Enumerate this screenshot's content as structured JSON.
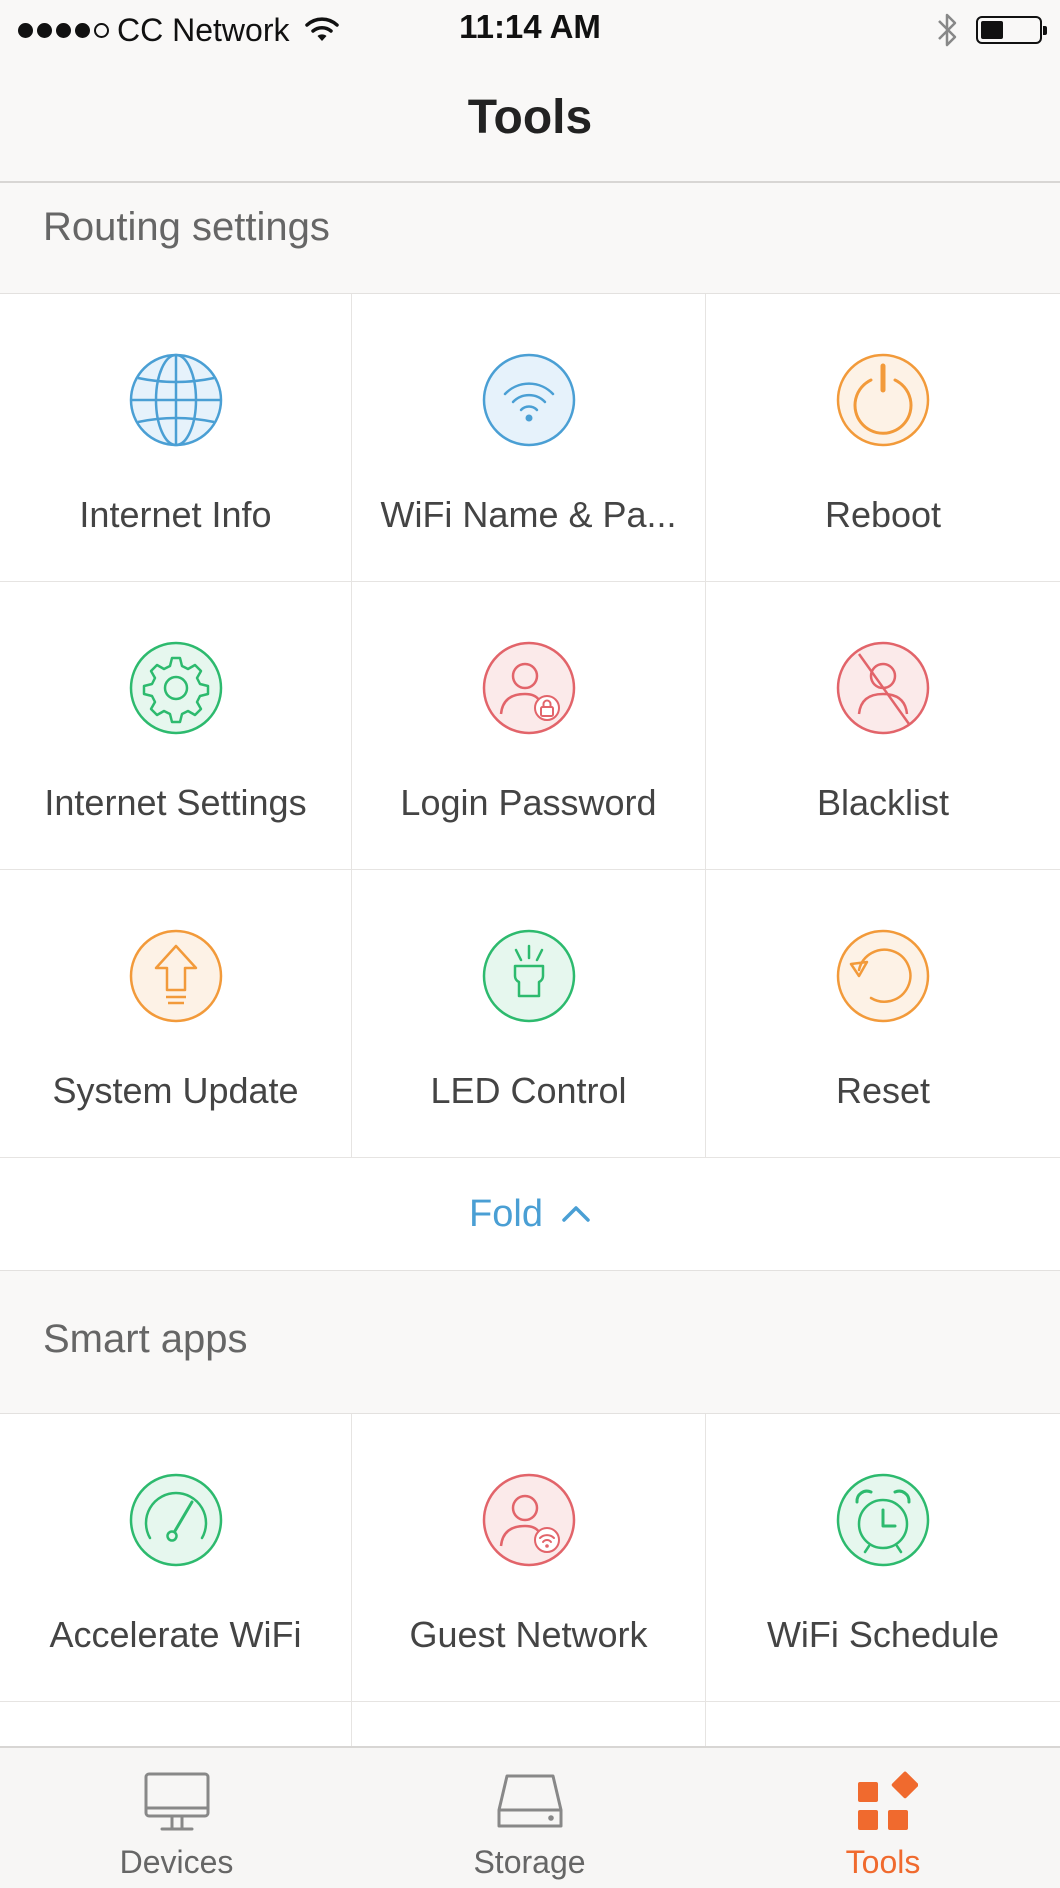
{
  "status_bar": {
    "carrier": "CC Network",
    "time": "11:14 AM",
    "battery_level": 0.4,
    "signal_bars": 4
  },
  "nav": {
    "title": "Tools"
  },
  "routing": {
    "header": "Routing settings",
    "items": [
      {
        "label": "Internet Info",
        "icon": "globe-icon",
        "color": "#4a9fd4"
      },
      {
        "label": "WiFi Name & Pa...",
        "icon": "wifi-icon",
        "color": "#4a9fd4"
      },
      {
        "label": "Reboot",
        "icon": "power-icon",
        "color": "#f29a3a"
      },
      {
        "label": "Internet Settings",
        "icon": "gear-icon",
        "color": "#2dba6e"
      },
      {
        "label": "Login Password",
        "icon": "user-lock-icon",
        "color": "#e2646a"
      },
      {
        "label": "Blacklist",
        "icon": "user-blocked-icon",
        "color": "#e2646a"
      },
      {
        "label": "System Update",
        "icon": "upload-arrow-icon",
        "color": "#f29a3a"
      },
      {
        "label": "LED Control",
        "icon": "light-icon",
        "color": "#2dba6e"
      },
      {
        "label": "Reset",
        "icon": "reset-icon",
        "color": "#f29a3a"
      }
    ],
    "fold_label": "Fold"
  },
  "smart_apps": {
    "header": "Smart apps",
    "items": [
      {
        "label": "Accelerate WiFi",
        "icon": "speedometer-icon",
        "color": "#2dba6e"
      },
      {
        "label": "Guest Network",
        "icon": "user-wifi-icon",
        "color": "#e2646a"
      },
      {
        "label": "WiFi Schedule",
        "icon": "alarm-clock-icon",
        "color": "#2dba6e"
      }
    ]
  },
  "tab_bar": {
    "tabs": [
      {
        "label": "Devices",
        "icon": "monitor-icon",
        "active": false
      },
      {
        "label": "Storage",
        "icon": "hard-drive-icon",
        "active": false
      },
      {
        "label": "Tools",
        "icon": "tools-grid-icon",
        "active": true
      }
    ],
    "active_color": "#f06a2e",
    "inactive_color": "#666666"
  }
}
